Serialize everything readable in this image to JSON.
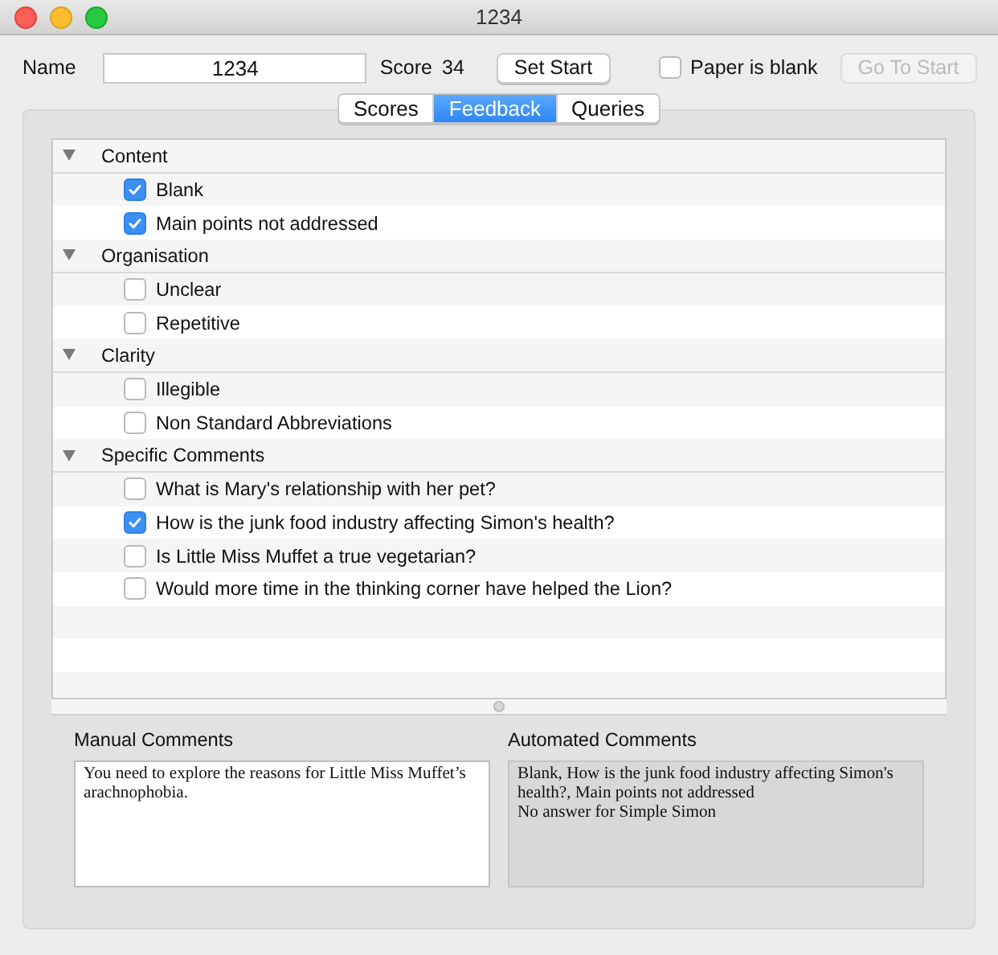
{
  "window": {
    "title": "1234"
  },
  "toolbar": {
    "name_label": "Name",
    "name_value": "1234",
    "score_label": "Score",
    "score_value": "34",
    "set_start": "Set Start",
    "paper_blank": {
      "label": "Paper is blank",
      "checked": false
    },
    "go_to_start": {
      "label": "Go To Start",
      "disabled": true
    }
  },
  "tabs": [
    {
      "label": "Scores",
      "selected": false
    },
    {
      "label": "Feedback",
      "selected": true
    },
    {
      "label": "Queries",
      "selected": false
    }
  ],
  "outline": [
    {
      "label": "Content",
      "expanded": true,
      "children": [
        {
          "label": "Blank",
          "checked": true
        },
        {
          "label": "Main points not addressed",
          "checked": true
        }
      ]
    },
    {
      "label": "Organisation",
      "expanded": true,
      "children": [
        {
          "label": "Unclear",
          "checked": false
        },
        {
          "label": "Repetitive",
          "checked": false
        }
      ]
    },
    {
      "label": "Clarity",
      "expanded": true,
      "children": [
        {
          "label": "Illegible",
          "checked": false
        },
        {
          "label": "Non Standard Abbreviations",
          "checked": false
        }
      ]
    },
    {
      "label": "Specific Comments",
      "expanded": true,
      "children": [
        {
          "label": "What is Mary's relationship with her pet?",
          "checked": false
        },
        {
          "label": "How is the junk food industry affecting Simon's health?",
          "checked": true
        },
        {
          "label": "Is Little Miss Muffet a true vegetarian?",
          "checked": false
        },
        {
          "label": "Would more time in the thinking corner have helped the Lion?",
          "checked": false
        }
      ]
    }
  ],
  "manual_comments": {
    "label": "Manual Comments",
    "value": "You need to explore the reasons for Little Miss Muffet’s arachnophobia."
  },
  "automated_comments": {
    "label": "Automated Comments",
    "value": "Blank, How is the junk food industry affecting Simon's health?, Main points not addressed\nNo answer for Simple Simon"
  }
}
